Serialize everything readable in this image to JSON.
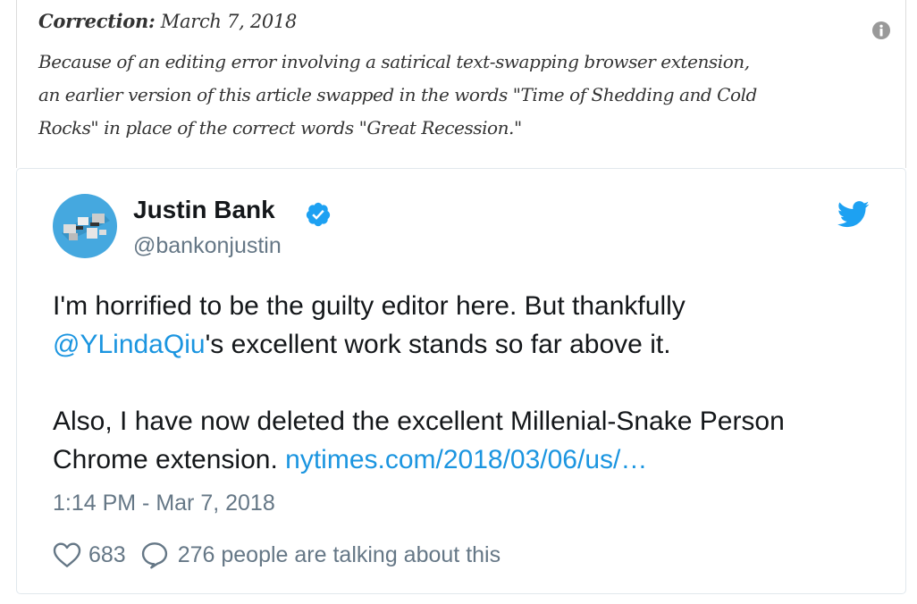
{
  "correction": {
    "label": "Correction:",
    "date": "March 7, 2018",
    "body_lines": [
      "Because of an editing error involving a satirical text-swapping browser extension,",
      "an earlier version of this article swapped in the words \"Time of Shedding and Cold",
      "Rocks\" in place of the correct words \"Great Recession.\""
    ],
    "info_icon": "info-icon"
  },
  "tweet": {
    "author_name": "Justin Bank",
    "handle": "@bankonjustin",
    "verified": true,
    "text": {
      "line1": "I'm horrified to be the guilty editor here. But thankfully",
      "mention": "@YLindaQiu",
      "line2_rest": "'s excellent work stands so far above it.",
      "line3": "Also, I have now deleted the excellent Millenial-Snake Person",
      "line4_start": "Chrome extension. ",
      "link": "nytimes.com/2018/03/06/us/…"
    },
    "timestamp": "1:14 PM - Mar 7, 2018",
    "like_count": "683",
    "talking_text": "276 people are talking about this",
    "icons": [
      "twitter-bird-icon",
      "verified-badge-icon",
      "heart-icon",
      "reply-bubble-icon"
    ]
  },
  "colors": {
    "link": "#1b95e0",
    "twitter_blue": "#1da1f2",
    "muted": "#657786",
    "text": "#14171a"
  }
}
